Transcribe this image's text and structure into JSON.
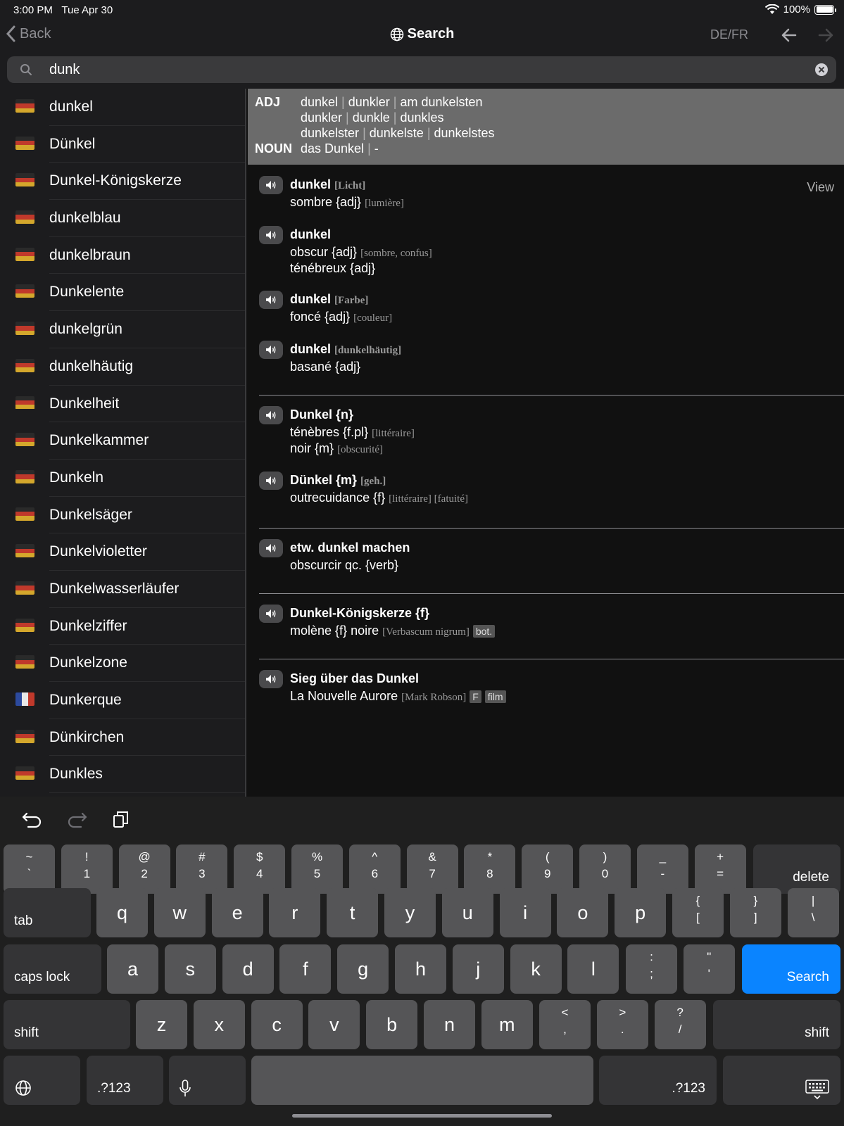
{
  "status": {
    "time": "3:00 PM",
    "date": "Tue Apr 30",
    "battery_pct": "100%",
    "battery_level": 1.0
  },
  "nav": {
    "back_label": "Back",
    "title": "Search",
    "lang_pair": "DE/FR"
  },
  "search": {
    "value": "dunk"
  },
  "sidebar": {
    "items": [
      {
        "label": "dunkel",
        "flag": "de"
      },
      {
        "label": "Dünkel",
        "flag": "de"
      },
      {
        "label": "Dunkel-Königskerze",
        "flag": "de"
      },
      {
        "label": "dunkelblau",
        "flag": "de"
      },
      {
        "label": "dunkelbraun",
        "flag": "de"
      },
      {
        "label": "Dunkelente",
        "flag": "de"
      },
      {
        "label": "dunkelgrün",
        "flag": "de"
      },
      {
        "label": "dunkelhäutig",
        "flag": "de"
      },
      {
        "label": "Dunkelheit",
        "flag": "de"
      },
      {
        "label": "Dunkelkammer",
        "flag": "de"
      },
      {
        "label": "Dunkeln",
        "flag": "de"
      },
      {
        "label": "Dunkelsäger",
        "flag": "de"
      },
      {
        "label": "Dunkelvioletter",
        "flag": "de"
      },
      {
        "label": "Dunkelwasserläufer",
        "flag": "de"
      },
      {
        "label": "Dunkelziffer",
        "flag": "de"
      },
      {
        "label": "Dunkelzone",
        "flag": "de"
      },
      {
        "label": "Dunkerque",
        "flag": "fr"
      },
      {
        "label": "Dünkirchen",
        "flag": "de"
      },
      {
        "label": "Dunkles",
        "flag": "de"
      }
    ]
  },
  "inflection": {
    "adj_label": "ADJ",
    "adj_rows": [
      [
        "dunkel",
        "dunkler",
        "am dunkelsten"
      ],
      [
        "dunkler",
        "dunkle",
        "dunkles"
      ],
      [
        "dunkelster",
        "dunkelste",
        "dunkelstes"
      ]
    ],
    "noun_label": "NOUN",
    "noun_row": [
      "das Dunkel",
      "-"
    ],
    "separator": "|"
  },
  "view_label": "View",
  "entries": {
    "e1": {
      "head": "dunkel",
      "ctx": "[Licht]",
      "l1": "sombre {adj}",
      "l1_ctx": "[lumière]"
    },
    "e2": {
      "head": "dunkel",
      "l1": "obscur {adj}",
      "l1_ctx": "[sombre, confus]",
      "l2": "ténébreux {adj}"
    },
    "e3": {
      "head": "dunkel",
      "ctx": "[Farbe]",
      "l1": "foncé {adj}",
      "l1_ctx": "[couleur]"
    },
    "e4": {
      "head": "dunkel",
      "ctx": "[dunkelhäutig]",
      "l1": "basané {adj}"
    },
    "e5": {
      "head": "Dunkel {n}",
      "l1": "ténèbres {f.pl}",
      "l1_ctx": "[littéraire]",
      "l2": "noir {m}",
      "l2_ctx": "[obscurité]"
    },
    "e6": {
      "head": "Dünkel {m}",
      "ctx": "[geh.]",
      "l1": "outrecuidance {f}",
      "l1_ctx": "[littéraire] [fatuité]"
    },
    "e7": {
      "head": "etw. dunkel machen",
      "l1": "obscurcir qc. {verb}"
    },
    "e8": {
      "head": "Dunkel-Königskerze {f}",
      "l1": "molène {f} noire",
      "l1_ctx": "[Verbascum nigrum]",
      "l1_tag": "bot."
    },
    "e9": {
      "head": "Sieg über das Dunkel",
      "l1": "La Nouvelle Aurore",
      "l1_ctx": "[Mark Robson]",
      "l1_tag1": "F",
      "l1_tag2": "film"
    }
  },
  "keyboard": {
    "row1": [
      {
        "top": "~",
        "bot": "`"
      },
      {
        "top": "!",
        "bot": "1"
      },
      {
        "top": "@",
        "bot": "2"
      },
      {
        "top": "#",
        "bot": "3"
      },
      {
        "top": "$",
        "bot": "4"
      },
      {
        "top": "%",
        "bot": "5"
      },
      {
        "top": "^",
        "bot": "6"
      },
      {
        "top": "&",
        "bot": "7"
      },
      {
        "top": "*",
        "bot": "8"
      },
      {
        "top": "(",
        "bot": "9"
      },
      {
        "top": ")",
        "bot": "0"
      },
      {
        "top": "_",
        "bot": "-"
      },
      {
        "top": "+",
        "bot": "="
      }
    ],
    "delete": "delete",
    "tab": "tab",
    "row2": [
      "q",
      "w",
      "e",
      "r",
      "t",
      "y",
      "u",
      "i",
      "o",
      "p"
    ],
    "row2_sym": [
      {
        "top": "{",
        "bot": "["
      },
      {
        "top": "}",
        "bot": "]"
      },
      {
        "top": "|",
        "bot": "\\"
      }
    ],
    "caps": "caps lock",
    "row3": [
      "a",
      "s",
      "d",
      "f",
      "g",
      "h",
      "j",
      "k",
      "l"
    ],
    "row3_sym": [
      {
        "top": ":",
        "bot": ";"
      },
      {
        "top": "\"",
        "bot": "'"
      }
    ],
    "search": "Search",
    "shift": "shift",
    "row4": [
      "z",
      "x",
      "c",
      "v",
      "b",
      "n",
      "m"
    ],
    "row4_sym": [
      {
        "top": "<",
        "bot": ","
      },
      {
        "top": ">",
        "bot": "."
      },
      {
        "top": "?",
        "bot": "/"
      }
    ],
    "numbers": ".?123"
  }
}
